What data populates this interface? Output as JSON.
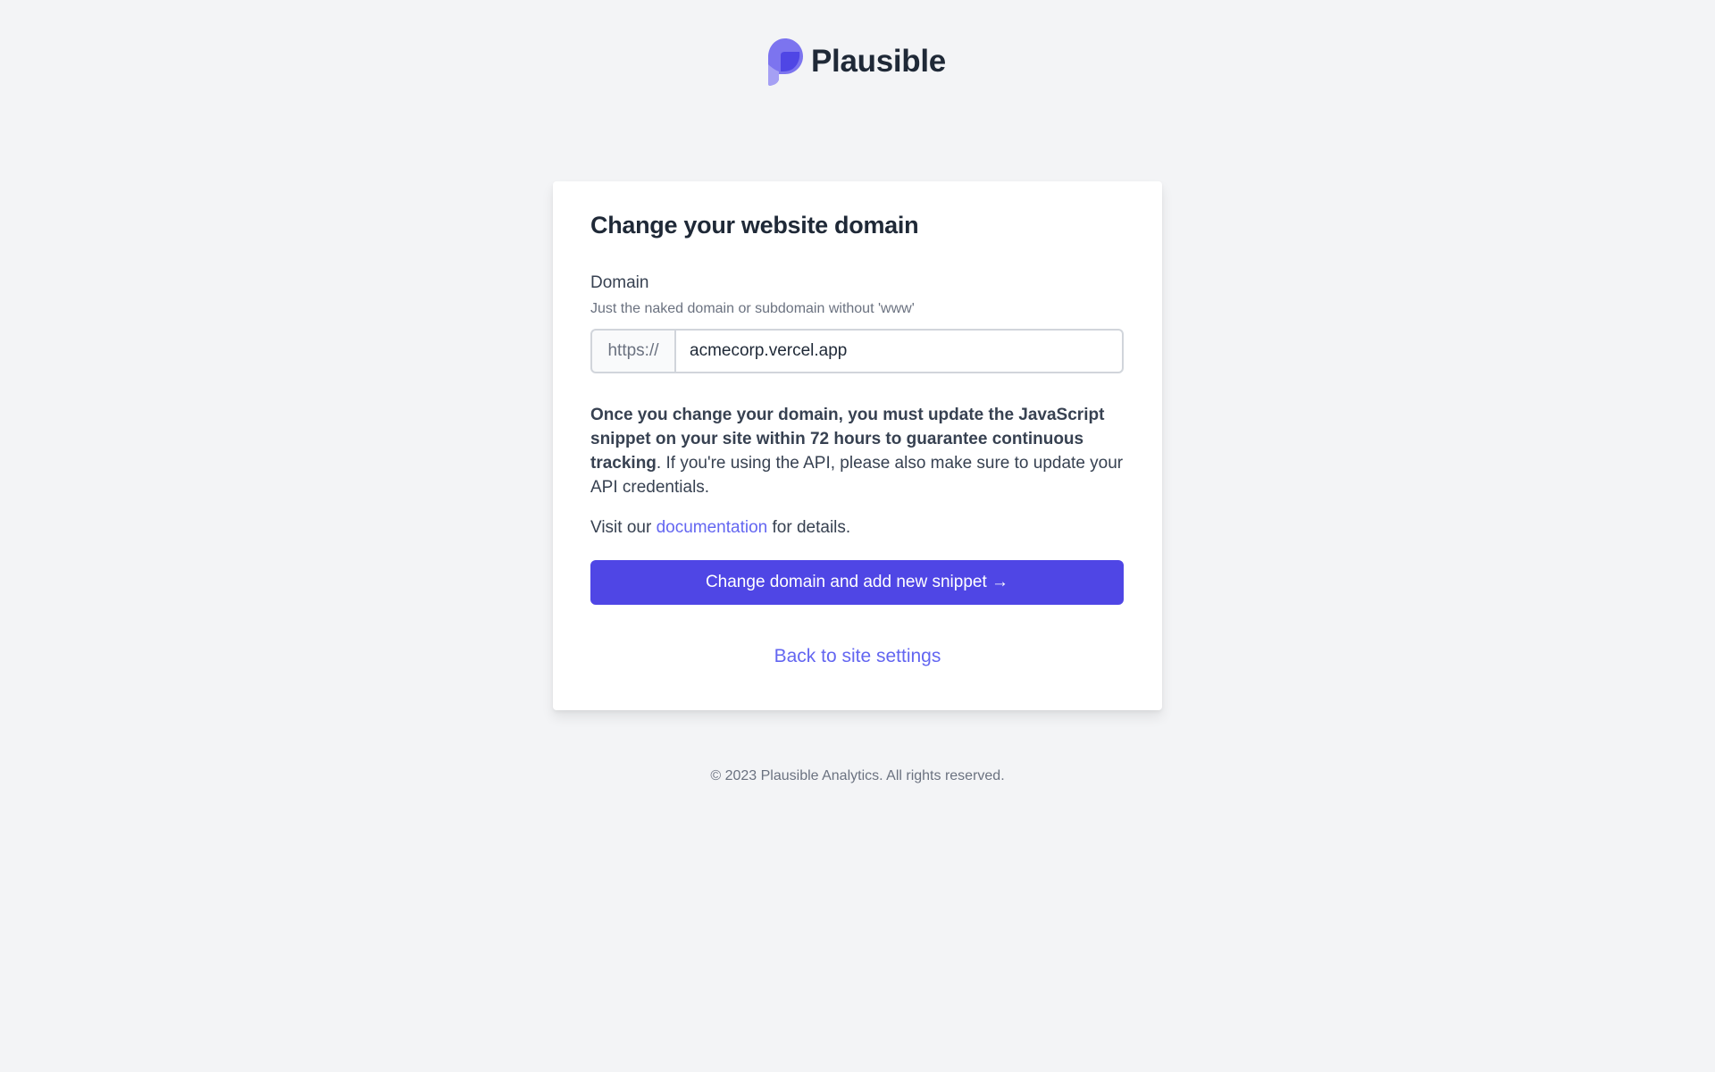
{
  "brand": {
    "name": "Plausible",
    "logo_icon": "plausible-logo-icon",
    "accent_color": "#4f46e5",
    "link_color": "#6366f1"
  },
  "form": {
    "title": "Change your website domain",
    "domain_label": "Domain",
    "domain_help": "Just the naked domain or subdomain without 'www'",
    "domain_prefix": "https://",
    "domain_value": "acmecorp.vercel.app",
    "notice_bold": "Once you change your domain, you must update the JavaScript snippet on your site within 72 hours to guarantee continuous tracking",
    "notice_rest": ". If you're using the API, please also make sure to update your API credentials.",
    "docs_prefix": "Visit our ",
    "docs_link": "documentation",
    "docs_suffix": " for details.",
    "submit_label": "Change domain and add new snippet →",
    "back_link": "Back to site settings"
  },
  "footer": {
    "copyright": "© 2023 Plausible Analytics. All rights reserved."
  }
}
